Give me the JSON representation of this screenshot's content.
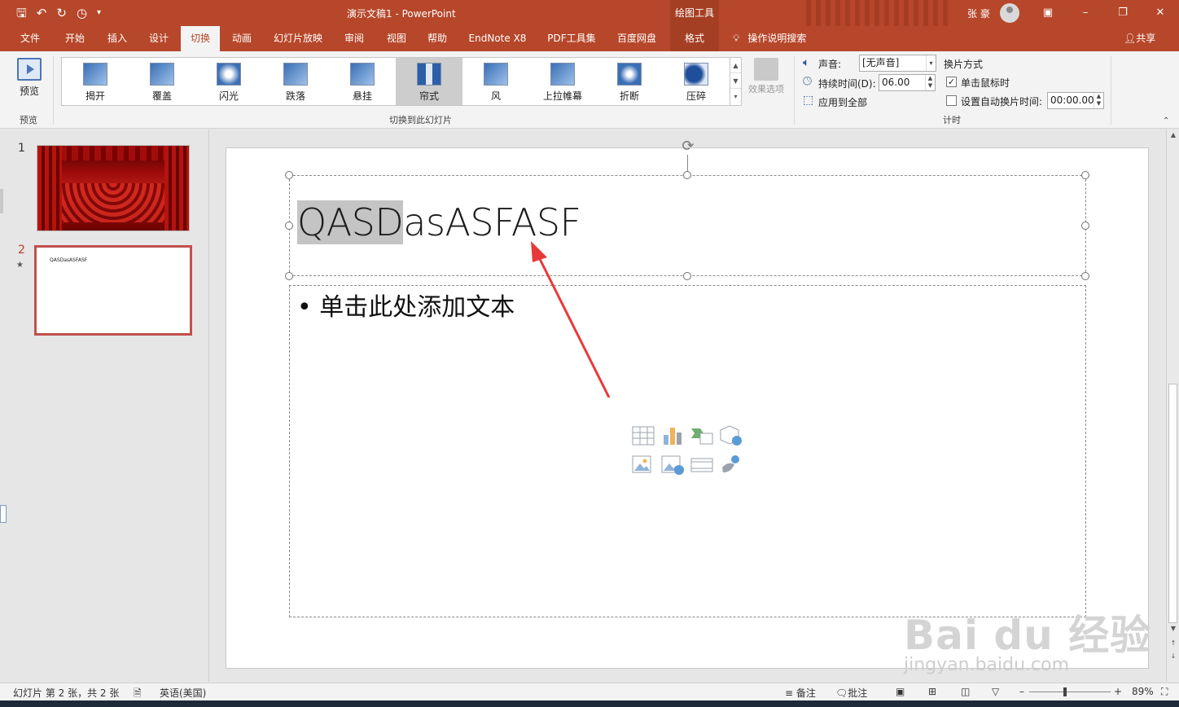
{
  "app": {
    "doc_title": "演示文稿1  -  PowerPoint",
    "context_label": "绘图工具",
    "user_name": "张 豪"
  },
  "tabs": [
    "文件",
    "开始",
    "插入",
    "设计",
    "切换",
    "动画",
    "幻灯片放映",
    "审阅",
    "视图",
    "帮助",
    "EndNote X8",
    "PDF工具集",
    "百度网盘",
    "格式"
  ],
  "active_tab": "切换",
  "tell_me": "操作说明搜索",
  "share": "共享",
  "ribbon": {
    "preview_label": "预览",
    "preview_group": "预览",
    "transitions_group": "切换到此幻灯片",
    "transitions": [
      {
        "name": "揭开"
      },
      {
        "name": "覆盖"
      },
      {
        "name": "闪光"
      },
      {
        "name": "跌落"
      },
      {
        "name": "悬挂"
      },
      {
        "name": "帘式",
        "selected": true
      },
      {
        "name": "风"
      },
      {
        "name": "上拉帷幕"
      },
      {
        "name": "折断"
      },
      {
        "name": "压碎"
      }
    ],
    "effect_options": "效果选项",
    "timing_group": "计时",
    "sound_label": "声音:",
    "sound_value": "[无声音]",
    "duration_label": "持续时间(D):",
    "duration_value": "06.00",
    "apply_all": "应用到全部",
    "advance_label": "换片方式",
    "on_click": "单击鼠标时",
    "on_click_checked": true,
    "after_label": "设置自动换片时间:",
    "after_checked": false,
    "after_value": "00:00.00"
  },
  "slides": [
    {
      "num": "1",
      "kind": "curtain-image"
    },
    {
      "num": "2",
      "title": "QASDasASFASF",
      "current": true
    }
  ],
  "slide": {
    "title_selected": "QASD",
    "title_rest": "asASFASF",
    "body_placeholder": "• 单击此处添加文本"
  },
  "watermark": {
    "main": "Bai du 经验",
    "sub": "jingyan.baidu.com"
  },
  "status": {
    "slide_info": "幻灯片 第 2 张，共 2 张",
    "language": "英语(美国)",
    "notes": "备注",
    "comments": "批注",
    "zoom": "89%",
    "zoom_level": 0.89
  },
  "colors": {
    "accent": "#b7472a",
    "arrow": "#e8393a",
    "selected_thumb_border": "#c0504d"
  }
}
